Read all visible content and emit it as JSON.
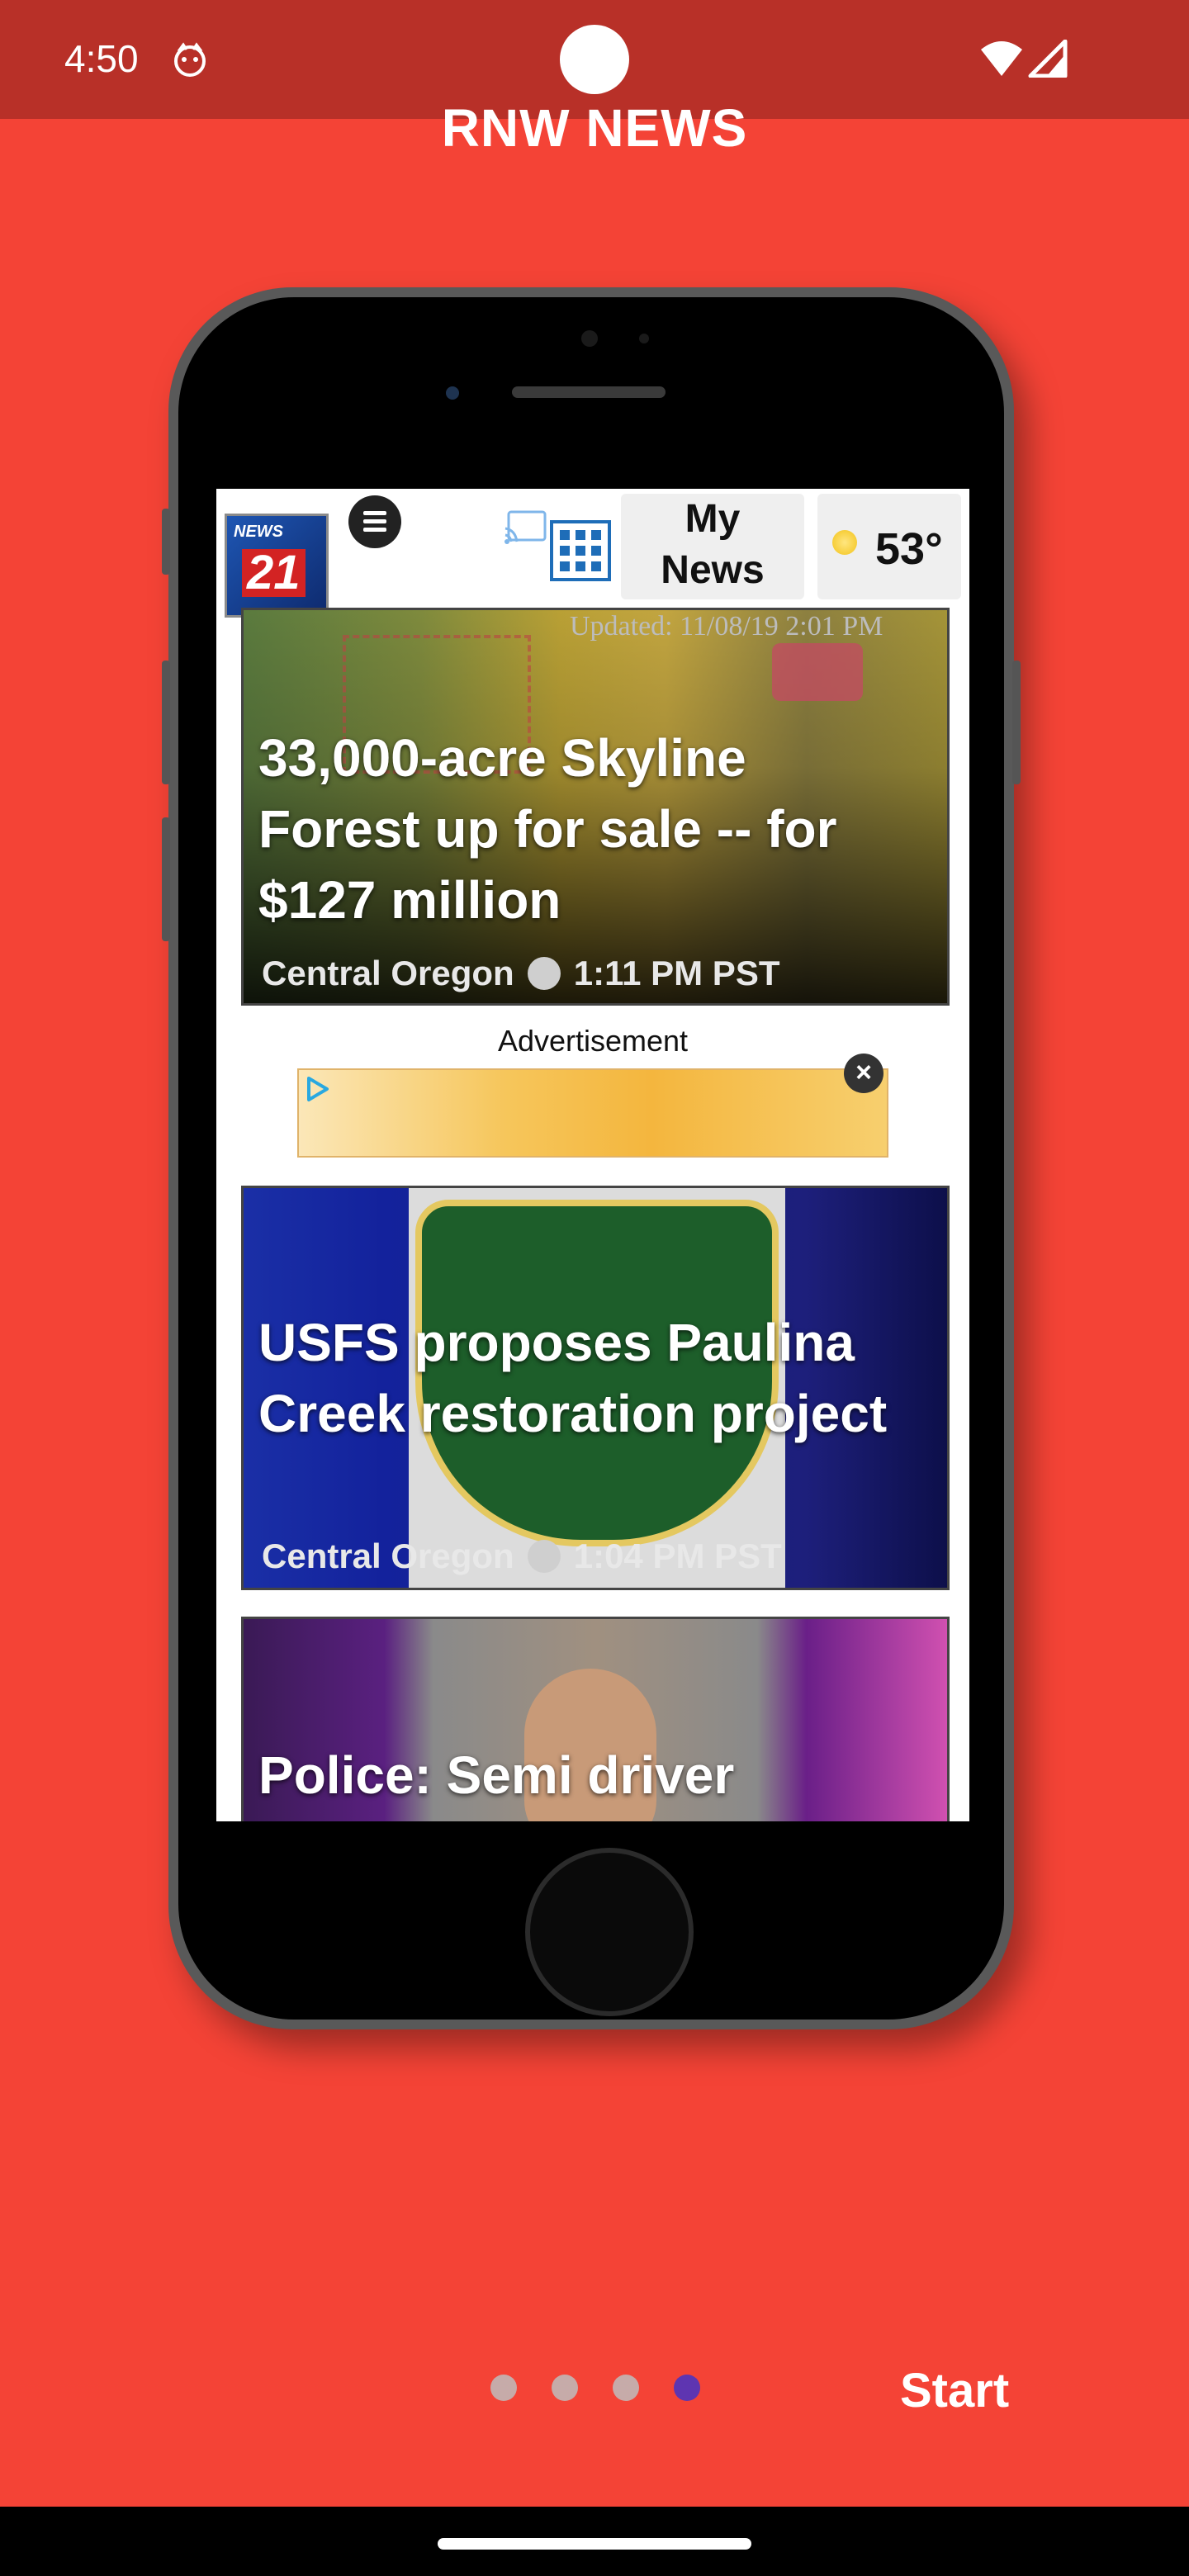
{
  "status_bar": {
    "time": "4:50",
    "icons": [
      "notification-face-icon",
      "wifi-icon",
      "signal-icon"
    ]
  },
  "app_title": "RNW NEWS",
  "phone_screen": {
    "header": {
      "logo_text_top": "NEWS",
      "logo_text_number": "21",
      "my_news_label_line1": "My",
      "my_news_label_line2": "News",
      "temperature": "53°",
      "icons": [
        "menu-icon",
        "cast-icon",
        "grid-icon",
        "sun-icon"
      ]
    },
    "updated_text": "Updated: 11/08/19 2:01 PM",
    "articles": [
      {
        "headline": "33,000-acre Skyline Forest up for sale -- for $127 million",
        "region": "Central Oregon",
        "time": "1:11 PM PST"
      },
      {
        "headline": "USFS proposes Paulina Creek restoration project",
        "region": "Central Oregon",
        "time": "1:04 PM PST"
      },
      {
        "headline": "Police: Semi driver"
      }
    ],
    "ad": {
      "label": "Advertisement",
      "close_symbol": "×"
    }
  },
  "onboarding": {
    "page_count": 4,
    "active_page": 4,
    "dot_color": "#BDBDBD",
    "active_dot_color": "#5E35B1",
    "start_label": "Start"
  },
  "colors": {
    "background": "#F44336",
    "status_bar": "#B83028"
  }
}
